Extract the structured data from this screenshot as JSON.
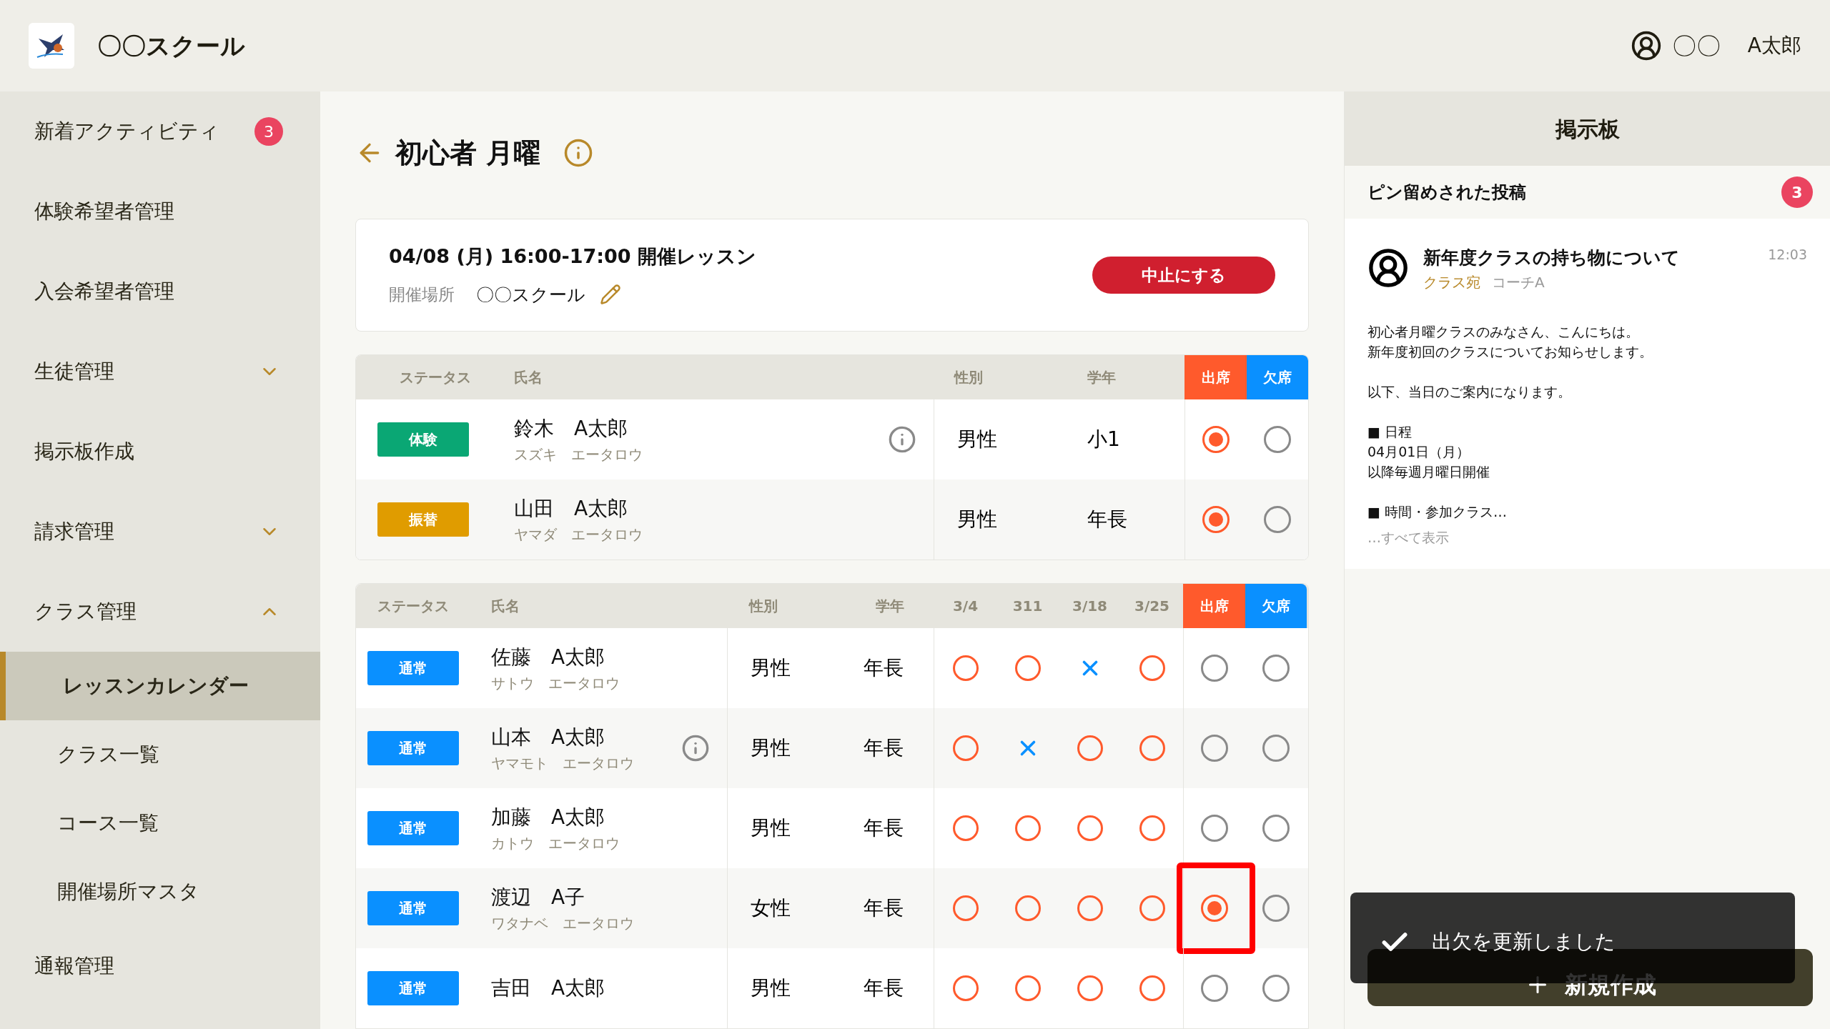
{
  "header": {
    "school_name": "〇〇スクール",
    "user_initials": "〇〇",
    "user_name": "A太郎"
  },
  "sidebar": {
    "items": [
      {
        "label": "新着アクティビティ",
        "badge": "3",
        "selected": false
      },
      {
        "label": "体験希望者管理",
        "selected": false
      },
      {
        "label": "入会希望者管理",
        "selected": false
      },
      {
        "label": "生徒管理",
        "selected": false,
        "expanded": false
      },
      {
        "label": "掲示板作成",
        "selected": false
      },
      {
        "label": "請求管理",
        "selected": false,
        "expanded": false
      },
      {
        "label": "クラス管理",
        "selected": false,
        "expanded": true,
        "children": [
          {
            "label": "レッスンカレンダー",
            "selected": true
          },
          {
            "label": "クラス一覧",
            "selected": false
          },
          {
            "label": "コース一覧",
            "selected": false
          },
          {
            "label": "開催場所マスタ",
            "selected": false
          }
        ]
      },
      {
        "label": "通報管理",
        "selected": false
      }
    ]
  },
  "page": {
    "title": "初心者 月曜"
  },
  "lesson": {
    "schedule": "04/08 (月) 16:00-17:00 開催レッスン",
    "location_label": "開催場所",
    "location": "〇〇スクール",
    "cancel_button": "中止にする"
  },
  "guest_table": {
    "columns": [
      "ステータス",
      "氏名",
      "性別",
      "学年",
      "出席",
      "欠席"
    ],
    "rows": [
      {
        "status": {
          "label": "体験",
          "kind": "trial"
        },
        "name": "鈴木　A太郎",
        "kana": "スズキ　エータロウ",
        "info": true,
        "gender": "男性",
        "grade": "小1",
        "present": true,
        "absent": false,
        "highlighted": false
      },
      {
        "status": {
          "label": "振替",
          "kind": "transfer"
        },
        "name": "山田　A太郎",
        "kana": "ヤマダ　エータロウ",
        "info": false,
        "gender": "男性",
        "grade": "年長",
        "present": true,
        "absent": false,
        "highlighted": false
      }
    ]
  },
  "member_table": {
    "columns": [
      "ステータス",
      "氏名",
      "性別",
      "学年",
      "3/4",
      "311",
      "3/18",
      "3/25",
      "出席",
      "欠席"
    ],
    "rows": [
      {
        "status": {
          "label": "通常",
          "kind": "regular"
        },
        "name": "佐藤　A太郎",
        "kana": "サトウ　エータロウ",
        "info": false,
        "gender": "男性",
        "grade": "年長",
        "history": [
          {
            "kind": "attended"
          },
          {
            "kind": "attended"
          },
          {
            "kind": "absent"
          },
          {
            "kind": "attended"
          }
        ],
        "present": false,
        "absent": false,
        "highlighted": false
      },
      {
        "status": {
          "label": "通常",
          "kind": "regular"
        },
        "name": "山本　A太郎",
        "kana": "ヤマモト　エータロウ",
        "info": true,
        "gender": "男性",
        "grade": "年長",
        "history": [
          {
            "kind": "attended"
          },
          {
            "kind": "absent"
          },
          {
            "kind": "attended"
          },
          {
            "kind": "attended"
          }
        ],
        "present": false,
        "absent": false,
        "highlighted": false
      },
      {
        "status": {
          "label": "通常",
          "kind": "regular"
        },
        "name": "加藤　A太郎",
        "kana": "カトウ　エータロウ",
        "info": false,
        "gender": "男性",
        "grade": "年長",
        "history": [
          {
            "kind": "attended"
          },
          {
            "kind": "attended"
          },
          {
            "kind": "attended"
          },
          {
            "kind": "attended"
          }
        ],
        "present": false,
        "absent": false,
        "highlighted": false
      },
      {
        "status": {
          "label": "通常",
          "kind": "regular"
        },
        "name": "渡辺　A子",
        "kana": "ワタナベ　エータロウ",
        "info": false,
        "gender": "女性",
        "grade": "年長",
        "history": [
          {
            "kind": "attended"
          },
          {
            "kind": "attended"
          },
          {
            "kind": "attended"
          },
          {
            "kind": "attended"
          }
        ],
        "present": true,
        "absent": false,
        "highlighted": true
      },
      {
        "status": {
          "label": "通常",
          "kind": "regular"
        },
        "name": "吉田　A太郎",
        "info": false,
        "gender": "男性",
        "grade": "年長",
        "history": [
          {
            "kind": "attended"
          },
          {
            "kind": "attended"
          },
          {
            "kind": "attended"
          },
          {
            "kind": "attended"
          }
        ],
        "present": false,
        "absent": false,
        "highlighted": false
      }
    ]
  },
  "board": {
    "title": "掲示板",
    "pinned_label": "ピン留めされた投稿",
    "pinned_count": "3",
    "post": {
      "title": "新年度クラスの持ち物について",
      "audience": "クラス宛",
      "author": "コーチA",
      "time": "12:03",
      "paragraphs": [
        [
          "初心者月曜クラスのみなさん、こんにちは。",
          "新年度初回のクラスについてお知らせします。"
        ],
        [
          "以下、当日のご案内になります。"
        ],
        [
          "■ 日程",
          "04月01日（月）",
          "以降毎週月曜日開催"
        ],
        [
          "■ 時間・参加クラス…"
        ]
      ],
      "show_all": "…すべて表示"
    }
  },
  "new_button": "新規作成",
  "toast": {
    "message": "出欠を更新しました"
  }
}
